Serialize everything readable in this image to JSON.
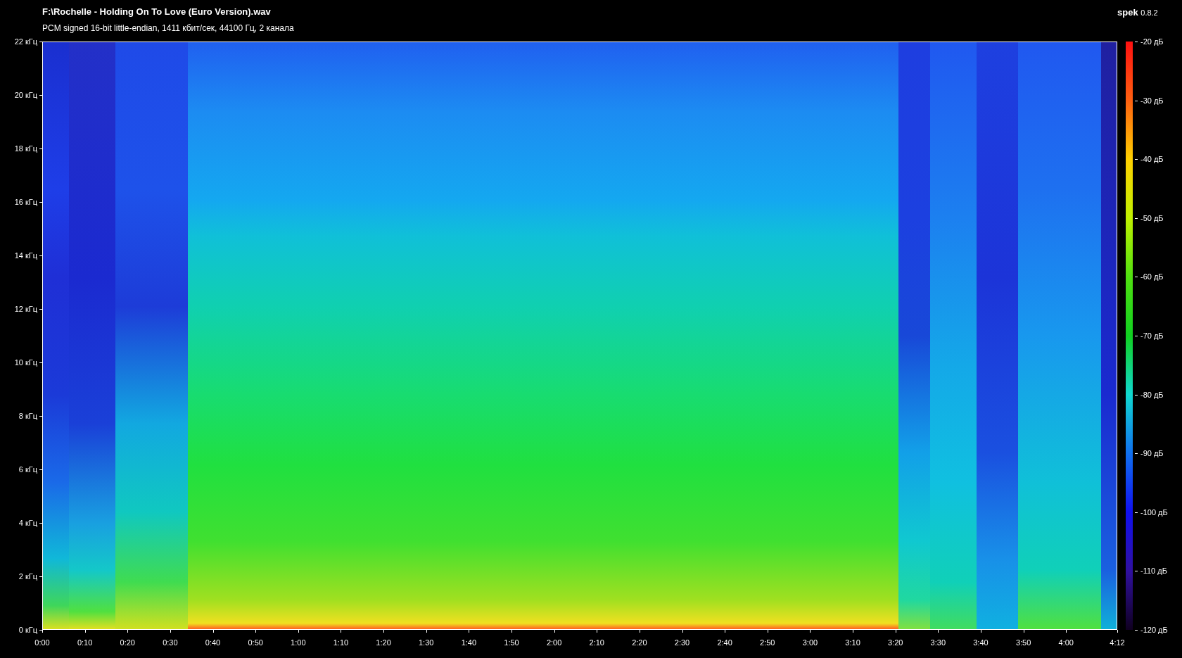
{
  "header": {
    "file_title": "F:\\Rochelle - Holding On To Love (Euro Version).wav",
    "stream_info": "PCM signed 16-bit little-endian, 1411 кбит/сек, 44100 Гц, 2 канала",
    "app_name": "spek",
    "app_version": "0.8.2"
  },
  "frequency_axis": [
    "22 кГц",
    "20 кГц",
    "18 кГц",
    "16 кГц",
    "14 кГц",
    "12 кГц",
    "10 кГц",
    "8 кГц",
    "6 кГц",
    "4 кГц",
    "2 кГц",
    "0 кГц"
  ],
  "time_axis": [
    "0:00",
    "0:10",
    "0:20",
    "0:30",
    "0:40",
    "0:50",
    "1:00",
    "1:10",
    "1:20",
    "1:30",
    "1:40",
    "1:50",
    "2:00",
    "2:10",
    "2:20",
    "2:30",
    "2:40",
    "2:50",
    "3:00",
    "3:10",
    "3:20",
    "3:30",
    "3:40",
    "3:50",
    "4:00",
    "4:12"
  ],
  "color_scale": [
    "-20 дБ",
    "-30 дБ",
    "-40 дБ",
    "-50 дБ",
    "-60 дБ",
    "-70 дБ",
    "-80 дБ",
    "-90 дБ",
    "-100 дБ",
    "-110 дБ",
    "-120 дБ"
  ]
}
